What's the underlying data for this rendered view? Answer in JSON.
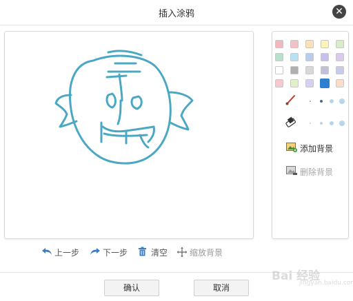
{
  "dialog": {
    "title": "插入涂鸦",
    "close_icon": "close-icon"
  },
  "palette": {
    "colors": [
      "#f2b8c0",
      "#f4c0c8",
      "#fbe0b8",
      "#fbf3b8",
      "#d8ecc8",
      "#b8e0cc",
      "#b8e2f4",
      "#b8ccf0",
      "#c8c0ec",
      "#dcc8f0",
      "#ffffff",
      "#b0b0b0",
      "#d8d8d8",
      "#c0c0d8",
      "#c8ccec",
      "#f8c8d0",
      "#e0f0c8",
      "#d8d0f4",
      "#2d7fd0",
      "#fbdcc8"
    ],
    "selected": "#2d7fd0"
  },
  "tools": {
    "brush_icon": "brush-icon",
    "eraser_icon": "eraser-icon"
  },
  "side_actions": {
    "add_bg": "添加背景",
    "remove_bg": "删除背景"
  },
  "toolbar": {
    "undo": "上一步",
    "redo": "下一步",
    "clear": "清空",
    "scale_bg": "缩放背景"
  },
  "footer": {
    "confirm": "确认",
    "cancel": "取消"
  },
  "watermark": {
    "text": "Bai 经验",
    "sub": "jingyan.baidu.com"
  },
  "colors": {
    "stroke": "#4aa8c4",
    "accent": "#2d7fd0"
  }
}
